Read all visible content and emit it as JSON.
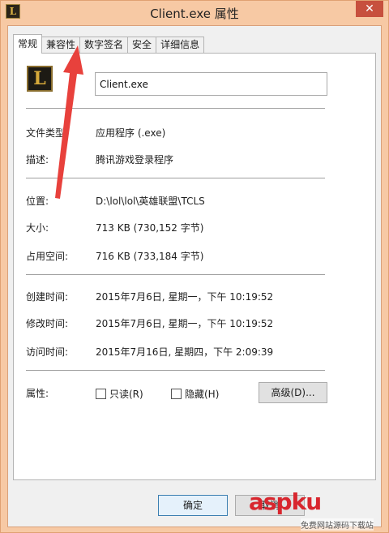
{
  "window": {
    "title": "Client.exe 属性",
    "close_glyph": "✕"
  },
  "tabs": [
    {
      "label": "常规",
      "active": true
    },
    {
      "label": "兼容性",
      "active": false
    },
    {
      "label": "数字签名",
      "active": false
    },
    {
      "label": "安全",
      "active": false
    },
    {
      "label": "详细信息",
      "active": false
    }
  ],
  "general": {
    "icon_letter": "L",
    "file_name": "Client.exe",
    "file_type_label": "文件类型:",
    "file_type_value": "应用程序 (.exe)",
    "description_label": "描述:",
    "description_value": "腾讯游戏登录程序",
    "location_label": "位置:",
    "location_value": "D:\\lol\\lol\\英雄联盟\\TCLS",
    "size_label": "大小:",
    "size_value": "713 KB (730,152 字节)",
    "disk_size_label": "占用空间:",
    "disk_size_value": "716 KB (733,184 字节)",
    "created_label": "创建时间:",
    "created_value": "2015年7月6日, 星期一，下午 10:19:52",
    "modified_label": "修改时间:",
    "modified_value": "2015年7月6日, 星期一，下午 10:19:52",
    "accessed_label": "访问时间:",
    "accessed_value": "2015年7月16日, 星期四，下午 2:09:39",
    "attributes_label": "属性:",
    "readonly_label": "只读(R)",
    "readonly_checked": false,
    "hidden_label": "隐藏(H)",
    "hidden_checked": false,
    "advanced_label": "高级(D)..."
  },
  "footer": {
    "ok_label": "确定",
    "cancel_label": "取消"
  },
  "annotation": {
    "arrow_color": "#e8413c"
  },
  "watermark": {
    "brand": "aspku",
    "tagline": "免费网站源码下载站"
  }
}
